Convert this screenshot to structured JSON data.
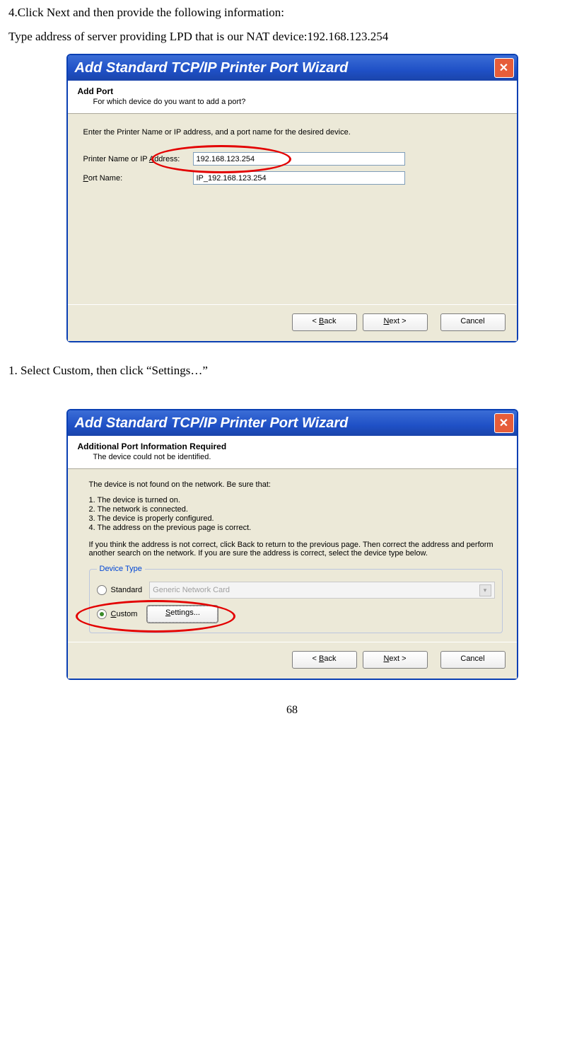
{
  "doc": {
    "step4": "4.Click Next and then provide the following information:",
    "step4b": "Type address of server providing LPD that is our NAT device:192.168.123.254",
    "step1": "1. Select Custom, then click “Settings…”",
    "page_num": "68"
  },
  "dlg1": {
    "title": "Add Standard TCP/IP Printer Port Wizard",
    "h1": "Add Port",
    "h2": "For which device do you want to add a port?",
    "prompt": "Enter the Printer Name or IP address, and a port name for the desired device.",
    "label_addr_pre": "Printer Name or IP ",
    "label_addr_u": "A",
    "label_addr_post": "ddress:",
    "label_port_u": "P",
    "label_port_post": "ort Name:",
    "val_addr": "192.168.123.254",
    "val_port": "IP_192.168.123.254",
    "btn_back_pre": "< ",
    "btn_back_u": "B",
    "btn_back_post": "ack",
    "btn_next_u": "N",
    "btn_next_post": "ext >",
    "btn_cancel": "Cancel"
  },
  "dlg2": {
    "title": "Add Standard TCP/IP Printer Port Wizard",
    "h1": "Additional Port Information Required",
    "h2": "The device could not be identified.",
    "line0": "The device is not found on the network.  Be sure that:",
    "li1": "1.   The device is turned on.",
    "li2": "2.   The network is connected.",
    "li3": "3.   The device is properly configured.",
    "li4": "4.   The address on the previous page is correct.",
    "para1": "If you think the address is not correct, click Back to return to the previous page.  Then correct the address and perform another search on the network.  If you are sure the address is correct, select the device type below.",
    "legend": "Device Type",
    "radio_std": "Standard",
    "radio_cus_u": "C",
    "radio_cus_post": "ustom",
    "combo": "Generic Network Card",
    "btn_settings_u": "S",
    "btn_settings_post": "ettings...",
    "btn_back_pre": "< ",
    "btn_back_u": "B",
    "btn_back_post": "ack",
    "btn_next_u": "N",
    "btn_next_post": "ext >",
    "btn_cancel": "Cancel"
  }
}
